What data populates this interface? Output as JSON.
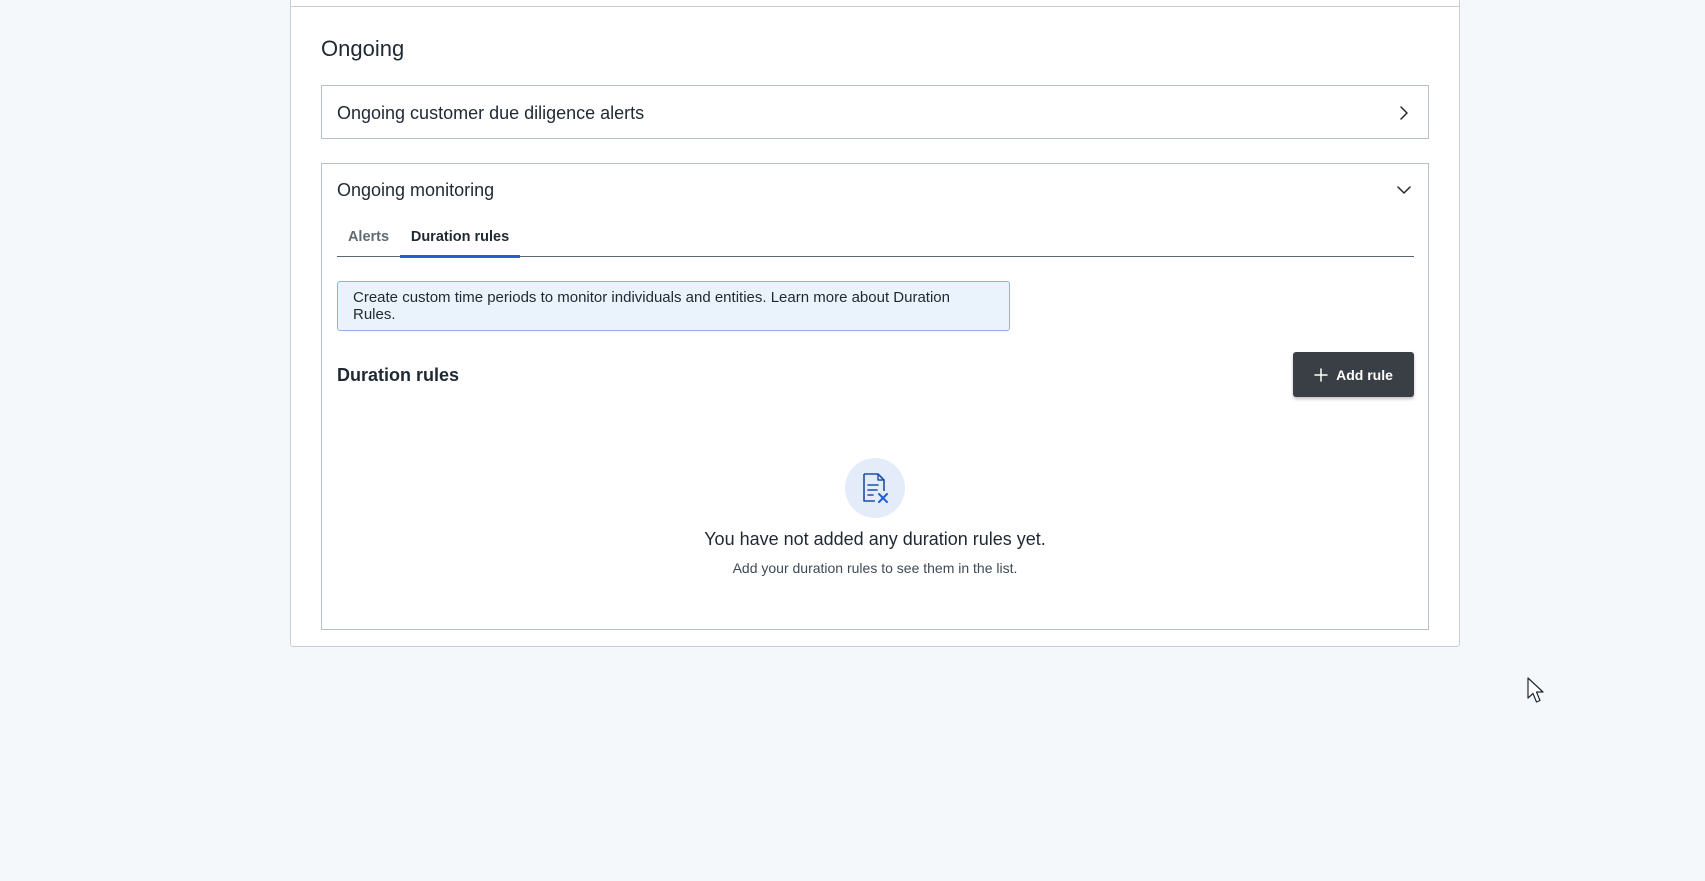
{
  "section": {
    "title": "Ongoing"
  },
  "accordions": [
    {
      "title": "Ongoing customer due diligence alerts",
      "state": "collapsed",
      "icon": "chevron-right-icon"
    },
    {
      "title": "Ongoing monitoring",
      "state": "expanded",
      "icon": "chevron-down-icon"
    }
  ],
  "tabs": [
    {
      "label": "Alerts",
      "active": false
    },
    {
      "label": "Duration rules",
      "active": true
    }
  ],
  "info_banner": {
    "text": "Create custom time periods to monitor individuals and entities. Learn more about Duration Rules."
  },
  "duration_rules": {
    "title": "Duration rules",
    "add_button_label": "Add rule",
    "add_button_icon": "plus-icon"
  },
  "empty_state": {
    "icon": "document-remove-icon",
    "title": "You have not added any duration rules yet.",
    "subtitle": "Add your duration rules to see them in the list."
  },
  "colors": {
    "accent": "#1f5fd1",
    "button_bg": "#3a3f45",
    "info_bg": "#eaf3fb",
    "page_bg": "#f5f8fb"
  }
}
